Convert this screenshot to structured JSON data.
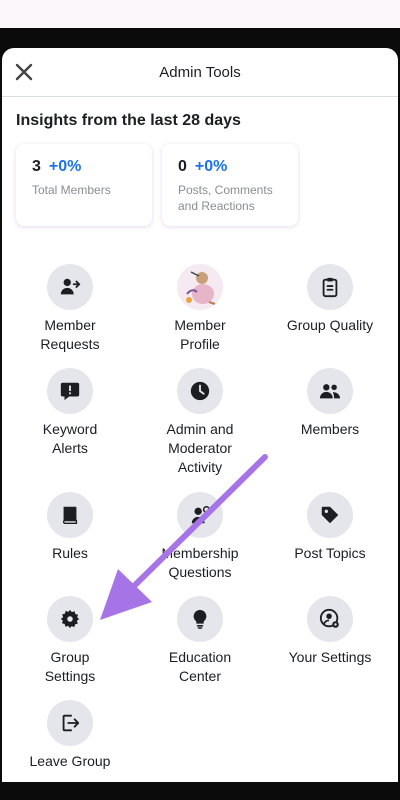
{
  "header": {
    "title": "Admin Tools",
    "close_icon": "close-icon"
  },
  "insights": {
    "title": "Insights from the last 28 days",
    "cards": [
      {
        "count": "3",
        "change": "+0%",
        "label": "Total Members"
      },
      {
        "count": "0",
        "change": "+0%",
        "label": "Posts, Comments and Reactions"
      }
    ]
  },
  "tools": [
    {
      "label": "Member\nRequests",
      "icon": "add-person-icon"
    },
    {
      "label": "Member\nProfile",
      "icon": "avatar"
    },
    {
      "label": "Group Quality",
      "icon": "clipboard-icon"
    },
    {
      "label": "Keyword\nAlerts",
      "icon": "alert-bubble-icon"
    },
    {
      "label": "Admin and\nModerator\nActivity",
      "icon": "clock-icon"
    },
    {
      "label": "Members",
      "icon": "people-icon"
    },
    {
      "label": "Rules",
      "icon": "book-icon"
    },
    {
      "label": "Membership\nQuestions",
      "icon": "person-question-icon"
    },
    {
      "label": "Post Topics",
      "icon": "tag-icon"
    },
    {
      "label": "Group\nSettings",
      "icon": "gear-icon"
    },
    {
      "label": "Education\nCenter",
      "icon": "lightbulb-icon"
    },
    {
      "label": "Your Settings",
      "icon": "person-gear-icon"
    },
    {
      "label": "Leave Group",
      "icon": "exit-icon"
    }
  ],
  "colors": {
    "accent": "#1b74e4",
    "annotation_arrow": "#a774e8"
  }
}
